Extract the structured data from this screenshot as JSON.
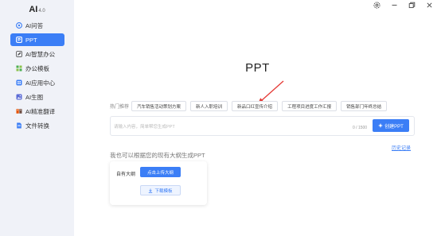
{
  "app": {
    "logo": "AI",
    "version": "4.0"
  },
  "sidebar": {
    "items": [
      {
        "label": "AI问答",
        "icon": "chat-icon",
        "active": false
      },
      {
        "label": "PPT",
        "icon": "ppt-icon",
        "active": true
      },
      {
        "label": "AI智慧办公",
        "icon": "edit-icon",
        "active": false
      },
      {
        "label": "办公模板",
        "icon": "template-icon",
        "active": false
      },
      {
        "label": "AI应用中心",
        "icon": "apps-icon",
        "active": false
      },
      {
        "label": "AI生图",
        "icon": "image-icon",
        "active": false
      },
      {
        "label": "AI精准翻译",
        "icon": "translate-icon",
        "active": false
      },
      {
        "label": "文件转换",
        "icon": "file-convert-icon",
        "active": false
      }
    ]
  },
  "main": {
    "title": "PPT",
    "hot_label": "热门推荐",
    "hot_topics": [
      "汽车销售活动策划方案",
      "新人入职培训",
      "新品口红宣传介绍",
      "工程项目进度工作汇报",
      "销售部门年终总结"
    ],
    "input": {
      "value": "",
      "placeholder": "请输入内容，简单帮您生成PPT",
      "counter": "0 / 1500"
    },
    "create_button": "创建PPT",
    "history_link": "历史记录",
    "outline_hint": "我也可以根据您的现有大纲生成PPT",
    "outline_card": {
      "label": "自有大纲",
      "upload_button": "点击上传大纲",
      "template_button": "下载模板"
    }
  },
  "colors": {
    "accent": "#3b7ef6",
    "sidebar_bg": "#f0f2f8",
    "arrow": "#e53935"
  }
}
